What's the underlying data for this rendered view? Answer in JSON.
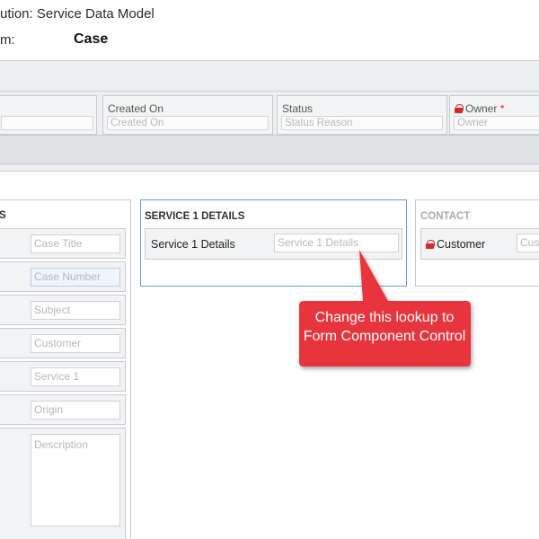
{
  "header": {
    "solution_text": "ution: Service Data Model",
    "form_label": "m:",
    "form_value": "Case"
  },
  "header_fields": [
    {
      "label": "Created On",
      "placeholder": "Created On"
    },
    {
      "label": "Status",
      "placeholder": "Status Reason"
    },
    {
      "label": "Owner",
      "required_marker": "*",
      "placeholder": "Owner"
    }
  ],
  "left_section": {
    "title": "S",
    "fields": [
      {
        "placeholder": "Case Title"
      },
      {
        "placeholder": "Case Number"
      },
      {
        "placeholder": "Subject"
      },
      {
        "placeholder": "Customer"
      },
      {
        "placeholder": "Service 1"
      },
      {
        "placeholder": "Origin"
      },
      {
        "placeholder": "Description"
      }
    ]
  },
  "service_section": {
    "title": "SERVICE 1 DETAILS",
    "field_label": "Service 1 Details",
    "field_placeholder": "Service 1 Details"
  },
  "contact_section": {
    "title": "CONTACT",
    "field_label": "Customer",
    "field_placeholder": "Cust"
  },
  "callout": {
    "text": "Change this lookup to Form Component Control",
    "color": "#e8363c"
  },
  "colors": {
    "lock": "#d9262c",
    "selected_border": "#6a9fb8",
    "band_bg": "#eceef0"
  }
}
